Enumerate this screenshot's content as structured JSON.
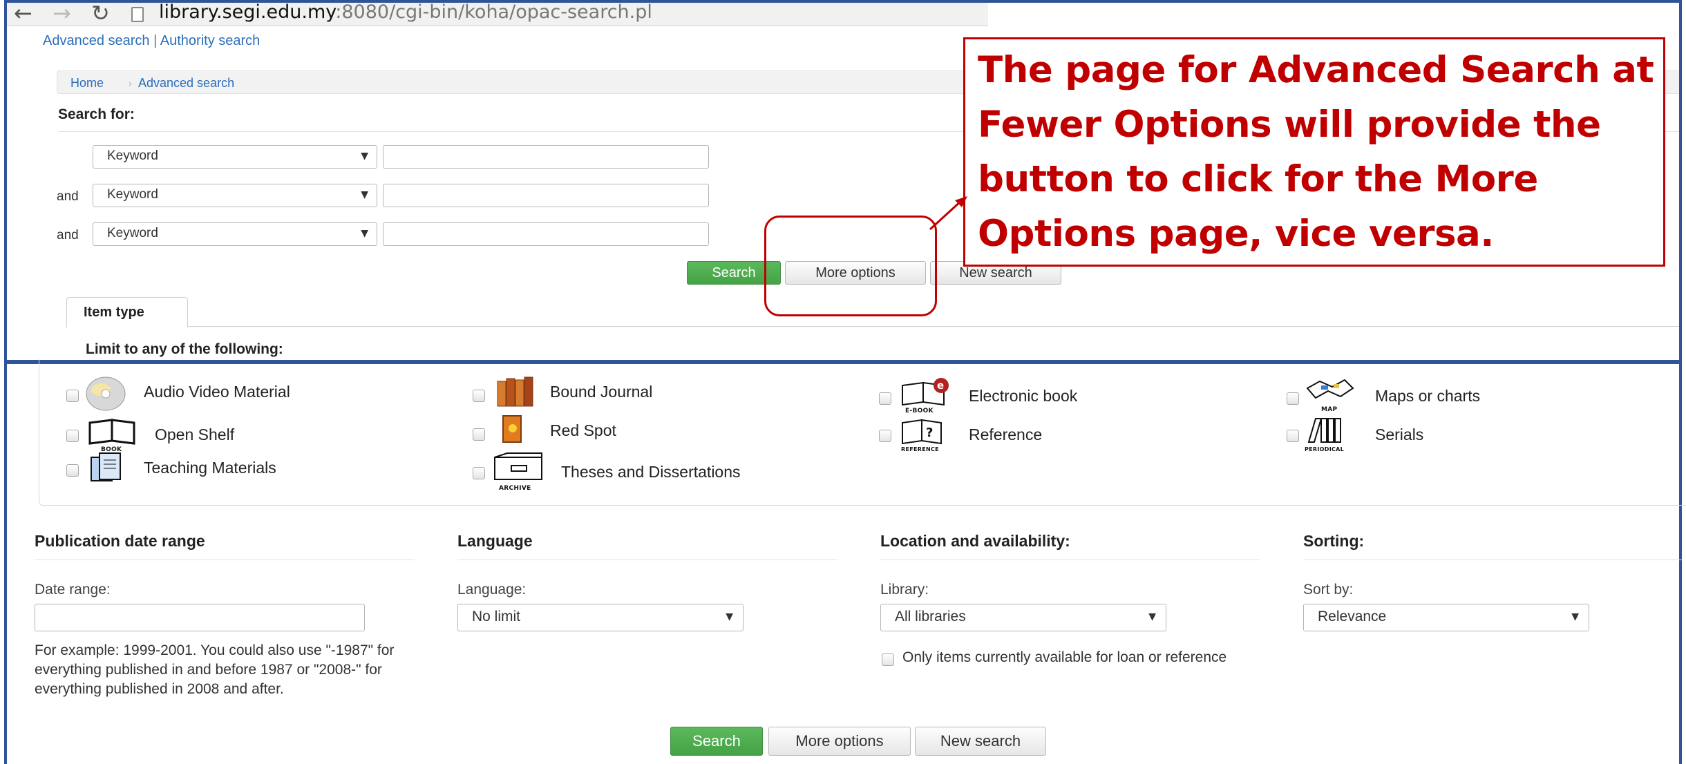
{
  "browser": {
    "url_host": "library.segi.edu.my",
    "url_rest": ":8080/cgi-bin/koha/opac-search.pl"
  },
  "top_links": {
    "advanced": "Advanced search",
    "separator": "|",
    "authority": "Authority search"
  },
  "breadcrumb": [
    "Home",
    "Advanced search"
  ],
  "search_for_label": "Search for:",
  "search_rows": [
    {
      "conjunction": "",
      "index": "Keyword",
      "value": ""
    },
    {
      "conjunction": "and",
      "index": "Keyword",
      "value": ""
    },
    {
      "conjunction": "and",
      "index": "Keyword",
      "value": ""
    }
  ],
  "buttons": {
    "search": "Search",
    "more_options": "More options",
    "new_search": "New search"
  },
  "tab_item_type": "Item type",
  "limit_label": "Limit to any of the following:",
  "callout": {
    "text": "The page for Advanced Search at Fewer Options will provide the button to click for the More Options page, vice versa."
  },
  "item_types": [
    {
      "label": "Audio Video Material",
      "icon": "cd-disc-icon",
      "caption": ""
    },
    {
      "label": "Bound Journal",
      "icon": "bound-journal-icon",
      "caption": ""
    },
    {
      "label": "Electronic book",
      "icon": "ebook-icon",
      "caption": "E-BOOK"
    },
    {
      "label": "Maps or charts",
      "icon": "map-icon",
      "caption": "MAP"
    },
    {
      "label": "Open Shelf",
      "icon": "book-icon",
      "caption": "BOOK"
    },
    {
      "label": "Red Spot",
      "icon": "red-spot-book-icon",
      "caption": ""
    },
    {
      "label": "Reference",
      "icon": "reference-book-icon",
      "caption": "REFERENCE"
    },
    {
      "label": "Serials",
      "icon": "periodical-icon",
      "caption": "PERIODICAL"
    },
    {
      "label": "Teaching Materials",
      "icon": "teaching-folder-icon",
      "caption": ""
    },
    {
      "label": "Theses and Dissertations",
      "icon": "archive-box-icon",
      "caption": "ARCHIVE"
    }
  ],
  "publication": {
    "title": "Publication date range",
    "label": "Date range:",
    "value": "",
    "help": "For example: 1999-2001. You could also use \"-1987\" for everything published in and before 1987 or \"2008-\" for everything published in 2008 and after."
  },
  "language": {
    "title": "Language",
    "label": "Language:",
    "selected": "No limit"
  },
  "location": {
    "title": "Location and availability:",
    "label": "Library:",
    "selected": "All libraries",
    "availability_label": "Only items currently available for loan or reference"
  },
  "sorting": {
    "title": "Sorting:",
    "label": "Sort by:",
    "selected": "Relevance"
  },
  "colors": {
    "frame_border": "#2f5597",
    "callout_red": "#c00000",
    "link_blue": "#2a6ebb",
    "search_green": "#4cae4c"
  }
}
